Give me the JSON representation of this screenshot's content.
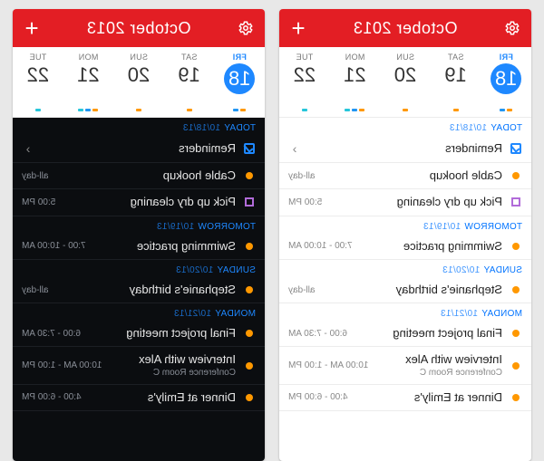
{
  "header": {
    "title": "October 2013",
    "add_icon": "plus-icon",
    "settings_icon": "gear-icon"
  },
  "week": [
    {
      "name": "FRI",
      "num": "18",
      "selected": true,
      "dots": [
        "o",
        "b"
      ]
    },
    {
      "name": "SAT",
      "num": "19",
      "selected": false,
      "dots": [
        "o"
      ]
    },
    {
      "name": "SUN",
      "num": "20",
      "selected": false,
      "dots": [
        "o"
      ]
    },
    {
      "name": "MON",
      "num": "21",
      "selected": false,
      "dots": [
        "o",
        "b",
        "t"
      ]
    },
    {
      "name": "TUE",
      "num": "22",
      "selected": false,
      "dots": [
        "t"
      ]
    }
  ],
  "sections": [
    {
      "label": "TODAY",
      "date": "10/18/13",
      "items": [
        {
          "kind": "check",
          "title": "Reminders",
          "meta": "",
          "chevron": true
        },
        {
          "kind": "orange",
          "title": "Cable hookup",
          "meta": "all-day"
        },
        {
          "kind": "box",
          "title": "Pick up dry cleaning",
          "meta": "5:00 PM"
        }
      ]
    },
    {
      "label": "TOMORROW",
      "date": "10/19/13",
      "items": [
        {
          "kind": "orange",
          "title": "Swimming practice",
          "meta": "7:00 - 10:00 AM"
        }
      ]
    },
    {
      "label": "SUNDAY",
      "date": "10/20/13",
      "items": [
        {
          "kind": "orange",
          "title": "Stephanie's birthday",
          "meta": "all-day"
        }
      ]
    },
    {
      "label": "MONDAY",
      "date": "10/21/13",
      "items": [
        {
          "kind": "orange",
          "title": "Final project meeting",
          "meta": "6:00 - 7:30 AM"
        },
        {
          "kind": "orange",
          "title": "Interview with Alex",
          "sub": "Conference Room C",
          "meta": "10:00 AM - 1:00 PM"
        },
        {
          "kind": "orange",
          "title": "Dinner at Emily's",
          "meta": "4:00 - 6:00 PM"
        }
      ]
    }
  ],
  "themes": [
    "dark",
    "light"
  ]
}
